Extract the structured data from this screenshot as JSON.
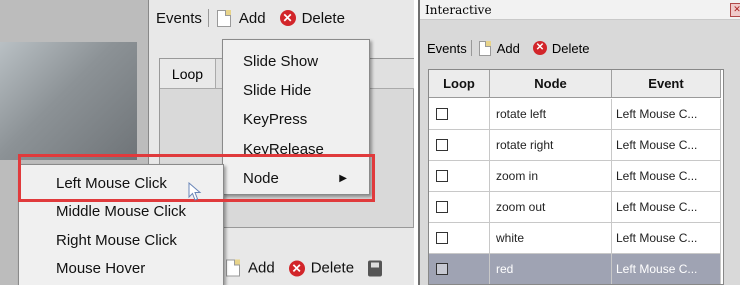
{
  "left": {
    "top_toolbar": {
      "events": "Events",
      "add": "Add",
      "delete": "Delete"
    },
    "bottom_toolbar": {
      "add": "Add",
      "delete": "Delete"
    },
    "grid_header": {
      "loop": "Loop"
    },
    "context_menu": {
      "items": [
        "Slide Show",
        "Slide Hide",
        "KeyPress",
        "KeyRelease",
        "Node"
      ]
    },
    "submenu": {
      "items": [
        "Left Mouse Click",
        "Middle Mouse Click",
        "Right Mouse Click",
        "Mouse Hover"
      ]
    }
  },
  "right": {
    "title": "Interactive",
    "close_glyph": "✕",
    "toolbar": {
      "events": "Events",
      "add": "Add",
      "delete": "Delete"
    },
    "table": {
      "columns": [
        "Loop",
        "Node",
        "Event"
      ],
      "rows": [
        {
          "node": "rotate left",
          "event": "Left Mouse C...",
          "selected": false
        },
        {
          "node": "rotate right",
          "event": "Left Mouse C...",
          "selected": false
        },
        {
          "node": "zoom in",
          "event": "Left Mouse C...",
          "selected": false
        },
        {
          "node": "zoom out",
          "event": "Left Mouse C...",
          "selected": false
        },
        {
          "node": "white",
          "event": "Left Mouse C...",
          "selected": false
        },
        {
          "node": "red",
          "event": "Left Mouse C...",
          "selected": true
        }
      ]
    }
  },
  "colors": {
    "highlight_border": "#e03a3c",
    "delete_icon": "#d2252a",
    "selected_row": "#9fa3b3"
  }
}
